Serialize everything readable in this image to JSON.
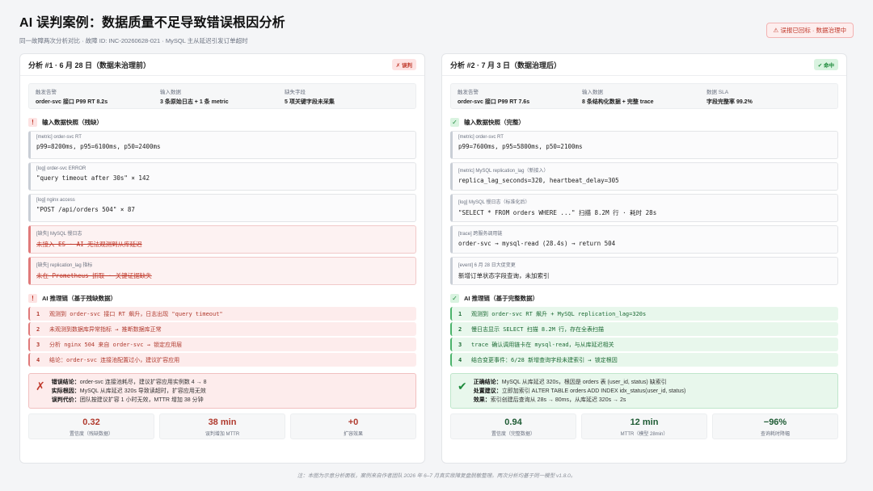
{
  "header": {
    "title": "AI 误判案例：数据质量不足导致错误根因分析",
    "subtitle": "同一故障两次分析对比 · 故障 ID: INC-20260628-021 · MySQL 主从延迟引发订单超时",
    "alert": "⚠ 误报已回标 · 数据治理中"
  },
  "left": {
    "title": "分析 #1 · 6 月 28 日（数据未治理前）",
    "badge": "✗ 误判",
    "meta": [
      {
        "k": "触发告警",
        "v": "order-svc 接口 P99 RT 8.2s"
      },
      {
        "k": "输入数据",
        "v": "3 条原始日志 + 1 条 metric"
      },
      {
        "k": "缺失字段",
        "v": "5 项关键字段未采集"
      }
    ],
    "input_title": "输入数据快照（残缺）",
    "items": [
      {
        "t": "[metric] order-svc RT",
        "v": "p99=8200ms, p95=6100ms, p50=2400ms",
        "miss": false
      },
      {
        "t": "[log] order-svc ERROR",
        "v": "\"query timeout after 30s\" × 142",
        "miss": false
      },
      {
        "t": "[log] nginx access",
        "v": "\"POST /api/orders 504\" × 87",
        "miss": false
      },
      {
        "t": "[缺失] MySQL 慢日志",
        "v": "未接入 ES · AI 无法观测到从库延迟",
        "miss": true
      },
      {
        "t": "[缺失] replication_lag 指标",
        "v": "未在 Prometheus 抓取 · 关键证据缺失",
        "miss": true
      }
    ],
    "chain_title": "AI 推理链（基于残缺数据）",
    "steps": [
      "观测到 order-svc 接口 RT 飙升，日志出现 \"query timeout\"",
      "未观测到数据库异常指标 → 推断数据库正常",
      "分析 nginx 504 来自 order-svc → 锁定应用层",
      "结论：order-svc 连接池配置过小，建议扩容应用"
    ],
    "conclusion": {
      "mark": "✗",
      "lines": [
        {
          "k": "错误结论：",
          "v": "order-svc 连接池耗尽，建议扩容应用实例数 4 → 8"
        },
        {
          "k": "实际根因：",
          "v": "MySQL 从库延迟 320s 导致读超时，扩容应用无效"
        },
        {
          "k": "误判代价：",
          "v": "团队按建议扩容 1 小时无效，MTTR 增加 38 分钟"
        }
      ]
    },
    "stats": [
      {
        "v": "0.32",
        "l": "置信度（残缺数据）"
      },
      {
        "v": "38 min",
        "l": "误判增加 MTTR"
      },
      {
        "v": "+0",
        "l": "扩容效果"
      }
    ]
  },
  "right": {
    "title": "分析 #2 · 7 月 3 日（数据治理后）",
    "badge": "✔ 命中",
    "meta": [
      {
        "k": "触发告警",
        "v": "order-svc 接口 P99 RT 7.6s"
      },
      {
        "k": "输入数据",
        "v": "8 条结构化数据 + 完整 trace"
      },
      {
        "k": "数据 SLA",
        "v": "字段完整率 99.2%"
      }
    ],
    "input_title": "输入数据快照（完整）",
    "items": [
      {
        "t": "[metric] order-svc RT",
        "v": "p99=7600ms, p95=5800ms, p50=2100ms",
        "miss": false
      },
      {
        "t": "[metric] MySQL replication_lag（新接入）",
        "v": "replica_lag_seconds=320, heartbeat_delay=305",
        "miss": false
      },
      {
        "t": "[log] MySQL 慢日志（标准化后）",
        "v": "\"SELECT * FROM orders WHERE ...\" 扫描 8.2M 行 · 耗时 28s",
        "miss": false
      },
      {
        "t": "[trace] 跨服务调用链",
        "v": "order-svc → mysql-read (28.4s) → return 504",
        "miss": false
      },
      {
        "t": "[event] 6 月 28 日大促变更",
        "v": "新增订单状态字段查询，未加索引",
        "miss": false
      }
    ],
    "chain_title": "AI 推理链（基于完整数据）",
    "steps": [
      "观测到 order-svc RT 飙升 + MySQL replication_lag=320s",
      "慢日志显示 SELECT 扫描 8.2M 行，存在全表扫描",
      "trace 确认调用链卡在 mysql-read，与从库延迟相关",
      "结合变更事件：6/28 新增查询字段未建索引 → 锁定根因"
    ],
    "conclusion": {
      "mark": "✔",
      "lines": [
        {
          "k": "正确结论：",
          "v": "MySQL 从库延迟 320s，根因是 orders 表 (user_id, status) 缺索引"
        },
        {
          "k": "处置建议：",
          "v": "立即加索引 ALTER TABLE orders ADD INDEX idx_status(user_id, status)"
        },
        {
          "k": "效果：",
          "v": "索引创建后查询从 28s → 80ms，从库延迟 320s → 2s"
        }
      ]
    },
    "stats": [
      {
        "v": "0.94",
        "l": "置信度（完整数据）"
      },
      {
        "v": "12 min",
        "l": "MTTR（模型 28min）"
      },
      {
        "v": "−96%",
        "l": "查询耗时降幅"
      }
    ]
  },
  "footer": "注：本图为示意分析面板，案例来自作者团队 2026 年 6–7 月真实故障复盘脱敏整理。两次分析均基于同一模型 v1.8.0。"
}
